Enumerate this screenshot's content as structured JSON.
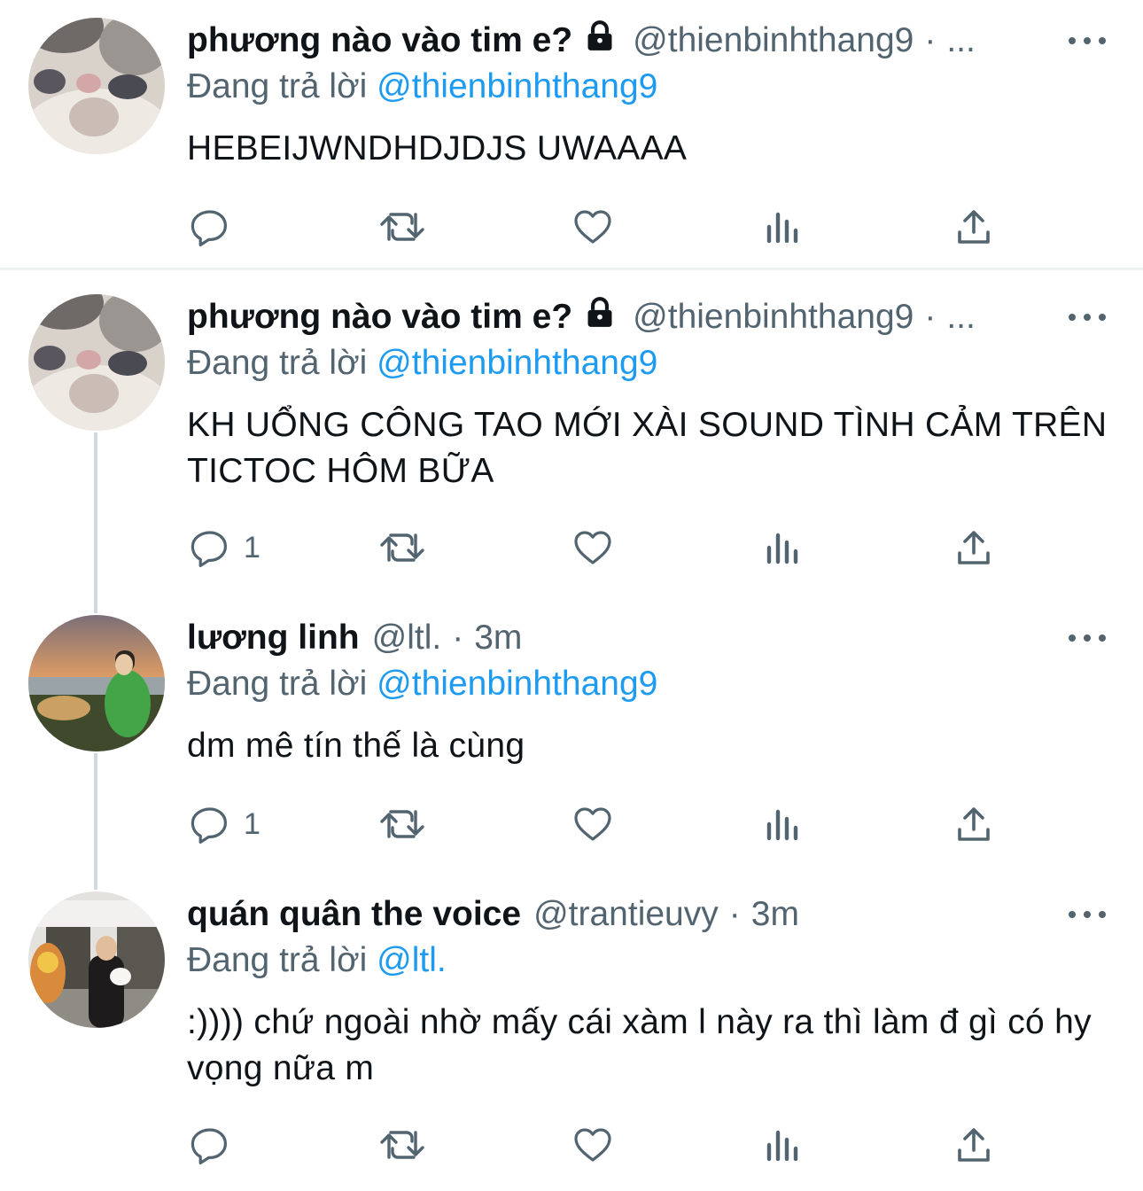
{
  "tweets": [
    {
      "name": "phương nào vào tim e?",
      "handle": "@thienbinhthang9",
      "time": "...",
      "replying_label": "Đang trả lời",
      "replying_to": "@thienbinhthang9",
      "text": "HEBEIJWNDHDJDJS UWAAAA",
      "locked": true,
      "reply_count": "",
      "avatar": "cat-avatar"
    },
    {
      "name": "phương nào vào tim e?",
      "handle": "@thienbinhthang9",
      "time": "...",
      "replying_label": "Đang trả lời",
      "replying_to": "@thienbinhthang9",
      "text": "KH UỔNG CÔNG TAO MỚI XÀI SOUND TÌNH CẢM TRÊN TICTOC HÔM BỮA",
      "locked": true,
      "reply_count": "1",
      "avatar": "cat-avatar"
    },
    {
      "name": "lương linh",
      "handle": "@ltl.",
      "time": "3m",
      "replying_label": "Đang trả lời",
      "replying_to": "@thienbinhthang9",
      "text": "dm mê tín thế là cùng",
      "locked": false,
      "reply_count": "1",
      "avatar": "beach-photo-avatar"
    },
    {
      "name": "quán quân the voice",
      "handle": "@trantieuvy",
      "time": "3m",
      "replying_label": "Đang trả lời",
      "replying_to": "@ltl.",
      "text": ":)))) chứ ngoài nhờ mấy cái xàm l này ra thì làm đ gì có hy vọng nữa m",
      "locked": false,
      "reply_count": "",
      "avatar": "street-photo-avatar"
    }
  ],
  "colors": {
    "text": "#0f1419",
    "secondary": "#536471",
    "link": "#1d9bf0",
    "divider": "#eff3f4",
    "thread_line": "#cfd9de"
  },
  "action_icons": [
    "reply-icon",
    "retweet-icon",
    "like-icon",
    "views-icon",
    "share-icon"
  ]
}
